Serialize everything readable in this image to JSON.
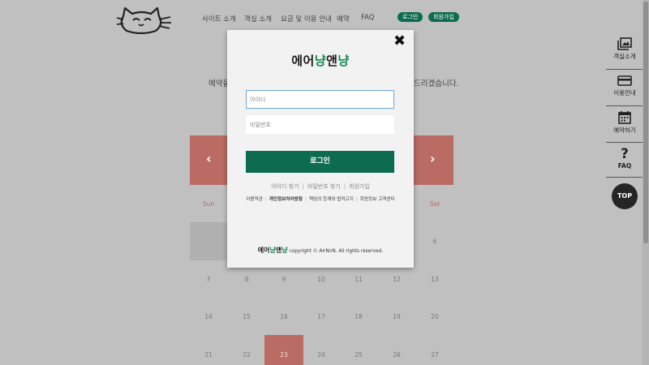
{
  "header": {
    "nav": [
      "사이트 소개",
      "객실 소개",
      "요금 및 이용 안내",
      "예약",
      "FAQ"
    ],
    "login_pill": "로그인",
    "signup_pill": "회원가입"
  },
  "intro": {
    "left": "예약을",
    "right": "드리겠습니다."
  },
  "calendar": {
    "prev": "‹",
    "next": "›",
    "dow_sun": "Sun",
    "dow_sat": "Sat",
    "row1": [
      "6"
    ],
    "row2": [
      "7",
      "8",
      "9",
      "10",
      "11",
      "12",
      "13"
    ],
    "row3": [
      "14",
      "15",
      "16",
      "17",
      "18",
      "19",
      "20"
    ],
    "row4": [
      "21",
      "22",
      "23",
      "24",
      "25",
      "26",
      "27"
    ],
    "accent": "#b96b64"
  },
  "sidebar": {
    "items": [
      {
        "label": "객실소개",
        "icon": "gallery-icon"
      },
      {
        "label": "이용안내",
        "icon": "card-icon"
      },
      {
        "label": "예약하기",
        "icon": "calendar-icon"
      },
      {
        "label": "FAQ",
        "icon": "question-icon"
      }
    ],
    "top": "TOP"
  },
  "modal": {
    "close": "✖",
    "brand": {
      "p1": "에어",
      "p2": "냥",
      "p3": "앤",
      "p4": "냥"
    },
    "id_placeholder": "아이디",
    "pw_placeholder": "비밀번호",
    "login_button": "로그인",
    "links": [
      "아이디 찾기",
      "비밀번호 찾기",
      "회원가입"
    ],
    "policies": [
      "이용약관",
      "개인정보처리방침",
      "책임의 한계와 법적고지",
      "회원정보 고객센터"
    ],
    "copyright": "copyright © AirNnN. All rights reserved.",
    "brand_color": "#0d6b4e"
  }
}
